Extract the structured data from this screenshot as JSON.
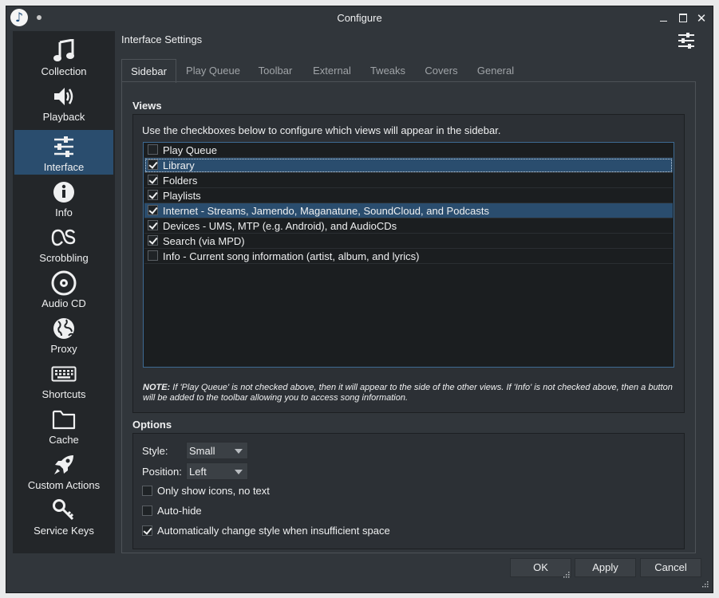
{
  "window": {
    "title": "Configure",
    "close_glyph": "✕"
  },
  "app_icon": {
    "glyph": "♪"
  },
  "sidebar": {
    "items": [
      {
        "label": "Collection",
        "icon": "music-note-icon"
      },
      {
        "label": "Playback",
        "icon": "speaker-icon"
      },
      {
        "label": "Interface",
        "icon": "sliders-icon",
        "active": true
      },
      {
        "label": "Info",
        "icon": "info-icon"
      },
      {
        "label": "Scrobbling",
        "icon": "lastfm-icon"
      },
      {
        "label": "Audio CD",
        "icon": "disc-icon"
      },
      {
        "label": "Proxy",
        "icon": "globe-icon"
      },
      {
        "label": "Shortcuts",
        "icon": "keyboard-icon"
      },
      {
        "label": "Cache",
        "icon": "folder-icon"
      },
      {
        "label": "Custom Actions",
        "icon": "rocket-icon"
      },
      {
        "label": "Service Keys",
        "icon": "key-icon"
      }
    ]
  },
  "page": {
    "title": "Interface Settings"
  },
  "tabs": [
    "Sidebar",
    "Play Queue",
    "Toolbar",
    "External",
    "Tweaks",
    "Covers",
    "General"
  ],
  "views": {
    "title": "Views",
    "hint": "Use the checkboxes below to configure which views will appear in the sidebar.",
    "items": [
      {
        "label": "Play Queue",
        "checked": false
      },
      {
        "label": "Library",
        "checked": true
      },
      {
        "label": "Folders",
        "checked": true
      },
      {
        "label": "Playlists",
        "checked": true
      },
      {
        "label": "Internet - Streams, Jamendo, Maganatune, SoundCloud, and Podcasts",
        "checked": true
      },
      {
        "label": "Devices - UMS, MTP (e.g. Android), and AudioCDs",
        "checked": true
      },
      {
        "label": "Search (via MPD)",
        "checked": true
      },
      {
        "label": "Info - Current song information (artist, album, and lyrics)",
        "checked": false
      }
    ],
    "note_prefix": "NOTE:",
    "note_text": " If 'Play Queue' is not checked above, then it will appear to the side of the other views. If 'Info' is not checked above, then a button will be added to the toolbar allowing you to access song information."
  },
  "options": {
    "title": "Options",
    "style_label": "Style:",
    "style_value": "Small",
    "position_label": "Position:",
    "position_value": "Left",
    "only_icons": {
      "label": "Only show icons, no text",
      "checked": false
    },
    "auto_hide": {
      "label": "Auto-hide",
      "checked": false
    },
    "auto_style": {
      "label": "Automatically change style when insufficient space",
      "checked": true
    }
  },
  "buttons": {
    "ok": "OK",
    "apply": "Apply",
    "cancel": "Cancel"
  }
}
